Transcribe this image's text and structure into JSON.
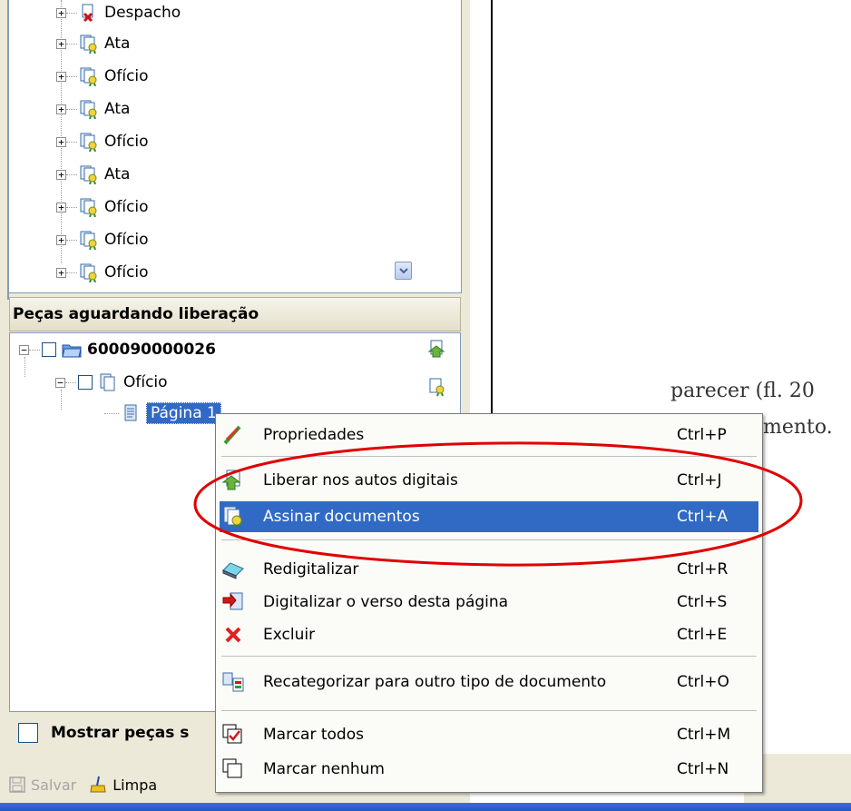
{
  "top_tree": {
    "items": [
      {
        "label": "Despacho",
        "icon": "cancelled-document-icon"
      },
      {
        "label": "Ata",
        "icon": "signed-document-icon"
      },
      {
        "label": "Ofício",
        "icon": "signed-document-icon"
      },
      {
        "label": "Ata",
        "icon": "signed-document-icon"
      },
      {
        "label": "Ofício",
        "icon": "signed-document-icon"
      },
      {
        "label": "Ata",
        "icon": "signed-document-icon"
      },
      {
        "label": "Ofício",
        "icon": "signed-document-icon"
      },
      {
        "label": "Ofício",
        "icon": "signed-document-icon"
      },
      {
        "label": "Ofício",
        "icon": "signed-document-icon"
      }
    ]
  },
  "pending": {
    "header": "Peças aguardando liberação",
    "root_label": "600090000026",
    "child_label": "Ofício",
    "page_label": "Página 1"
  },
  "show_pieces_label": "Mostrar peças s",
  "toolbar": {
    "save_label": "Salvar",
    "clear_label": "Limpa"
  },
  "document": {
    "line1": "parecer (fl. 20",
    "line2": "mento."
  },
  "context_menu": {
    "items": [
      {
        "label": "Propriedades",
        "shortcut": "Ctrl+P",
        "icon": "properties-icon"
      },
      {
        "label": "Liberar nos autos digitais",
        "shortcut": "Ctrl+J",
        "icon": "release-icon"
      },
      {
        "label": "Assinar documentos",
        "shortcut": "Ctrl+A",
        "icon": "sign-document-icon"
      },
      {
        "label": "Redigitalizar",
        "shortcut": "Ctrl+R",
        "icon": "scanner-icon"
      },
      {
        "label": "Digitalizar o verso desta página",
        "shortcut": "Ctrl+S",
        "icon": "scan-back-icon"
      },
      {
        "label": "Excluir",
        "shortcut": "Ctrl+E",
        "icon": "delete-icon"
      },
      {
        "label": "Recategorizar para outro tipo de documento",
        "shortcut": "Ctrl+O",
        "icon": "recategorize-icon"
      },
      {
        "label": "Marcar todos",
        "shortcut": "Ctrl+M",
        "icon": "check-all-icon"
      },
      {
        "label": "Marcar nenhum",
        "shortcut": "Ctrl+N",
        "icon": "check-none-icon"
      }
    ],
    "highlighted": "Assinar documentos"
  },
  "colors": {
    "panel": "#ece9d8",
    "highlight": "#316ac5",
    "annotation": "#e00000"
  }
}
